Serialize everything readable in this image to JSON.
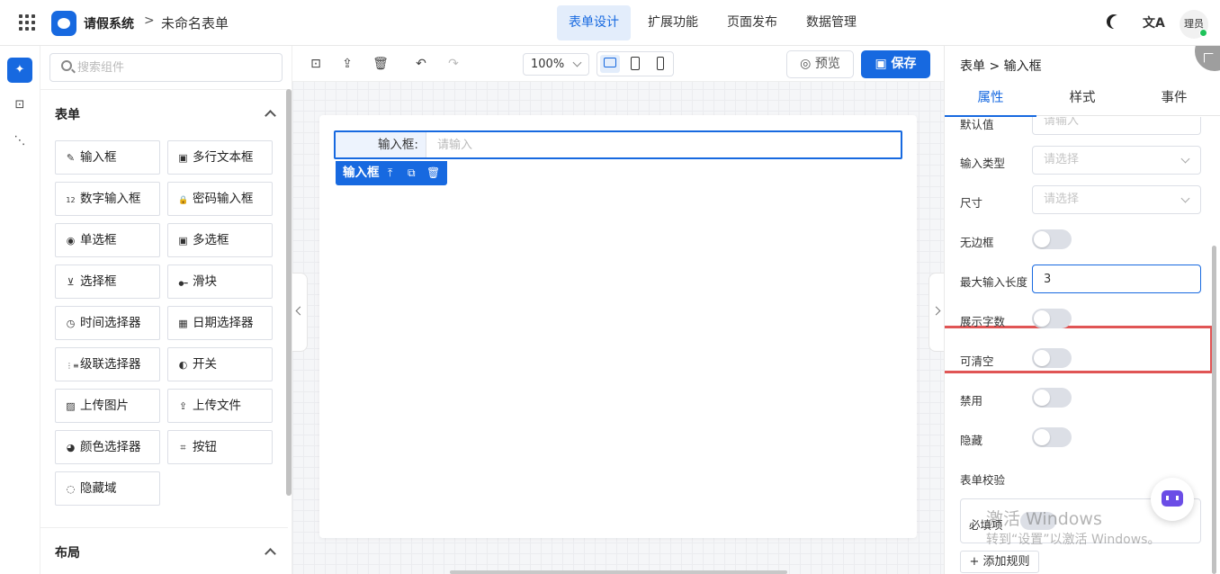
{
  "header": {
    "app_name": "请假系统",
    "breadcrumb_sep": ">",
    "form_name": "未命名表单",
    "tabs": [
      {
        "label": "表单设计",
        "active": true
      },
      {
        "label": "扩展功能",
        "active": false
      },
      {
        "label": "页面发布",
        "active": false
      },
      {
        "label": "数据管理",
        "active": false
      }
    ],
    "translate_glyph": "文A",
    "user_name": "理员",
    "accent_color": "#1769e0",
    "online_color": "#1fc35a"
  },
  "rail": {
    "items": [
      {
        "icon": "puzzle-icon",
        "glyph": "✦",
        "active": true
      },
      {
        "icon": "code-brackets-icon",
        "glyph": "⊡",
        "active": false
      },
      {
        "icon": "tree-structure-icon",
        "glyph": "⋱",
        "active": false
      }
    ]
  },
  "components": {
    "search_placeholder": "搜索组件",
    "sections": [
      {
        "title": "表单",
        "expanded": true
      },
      {
        "title": "布局",
        "expanded": true
      }
    ],
    "items": [
      {
        "label": "输入框",
        "icon": "pencil-icon",
        "glyph": "✎"
      },
      {
        "label": "多行文本框",
        "icon": "textarea-icon",
        "glyph": "▣"
      },
      {
        "label": "数字输入框",
        "icon": "number-icon",
        "glyph": "12"
      },
      {
        "label": "密码输入框",
        "icon": "lock-icon",
        "glyph": "🔒"
      },
      {
        "label": "单选框",
        "icon": "radio-icon",
        "glyph": "◉"
      },
      {
        "label": "多选框",
        "icon": "checkbox-icon",
        "glyph": "▣"
      },
      {
        "label": "选择框",
        "icon": "select-icon",
        "glyph": "⊻"
      },
      {
        "label": "滑块",
        "icon": "slider-icon",
        "glyph": "●━"
      },
      {
        "label": "时间选择器",
        "icon": "clock-icon",
        "glyph": "◷"
      },
      {
        "label": "日期选择器",
        "icon": "calendar-icon",
        "glyph": "▦"
      },
      {
        "label": "级联选择器",
        "icon": "cascade-icon",
        "glyph": "⋮≡"
      },
      {
        "label": "开关",
        "icon": "switch-icon",
        "glyph": "◐"
      },
      {
        "label": "上传图片",
        "icon": "image-icon",
        "glyph": "▨"
      },
      {
        "label": "上传文件",
        "icon": "upload-icon",
        "glyph": "⇪"
      },
      {
        "label": "颜色选择器",
        "icon": "palette-icon",
        "glyph": "◕"
      },
      {
        "label": "按钮",
        "icon": "button-icon",
        "glyph": "⌗"
      },
      {
        "label": "隐藏域",
        "icon": "eye-off-icon",
        "glyph": "◌"
      }
    ]
  },
  "toolbar": {
    "zoom": "100%",
    "preview_label": "预览",
    "save_label": "保存",
    "device": "desktop"
  },
  "canvas": {
    "field_label": "输入框:",
    "field_placeholder": "请输入",
    "selected_badge": "输入框"
  },
  "properties": {
    "breadcrumb": "表单 > 输入框",
    "tabs": [
      {
        "label": "属性",
        "active": true
      },
      {
        "label": "样式",
        "active": false
      },
      {
        "label": "事件",
        "active": false
      }
    ],
    "default_value": {
      "label": "默认值",
      "placeholder": "请输入"
    },
    "input_type": {
      "label": "输入类型",
      "placeholder": "请选择"
    },
    "size": {
      "label": "尺寸",
      "placeholder": "请选择"
    },
    "borderless": {
      "label": "无边框",
      "on": false
    },
    "max_length": {
      "label": "最大输入长度",
      "value": "3"
    },
    "show_count": {
      "label": "展示字数",
      "on": false
    },
    "clearable": {
      "label": "可清空",
      "on": false
    },
    "disabled": {
      "label": "禁用",
      "on": false
    },
    "hidden": {
      "label": "隐藏",
      "on": false
    },
    "validation_title": "表单校验",
    "required_label": "必填项",
    "add_rule_label": "+ 添加规则"
  },
  "watermark": {
    "line1": "激活 Windows",
    "line2": "转到“设置”以激活 Windows。"
  }
}
